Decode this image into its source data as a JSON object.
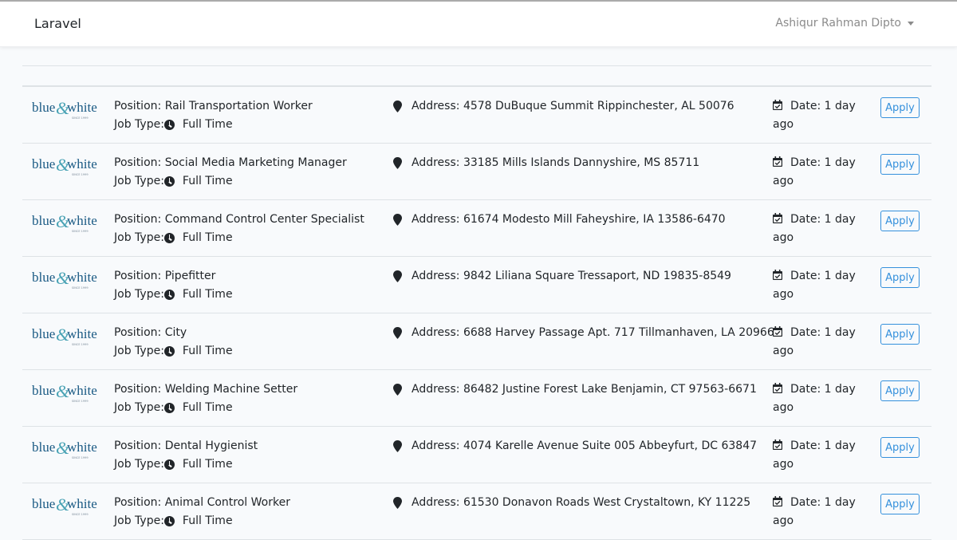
{
  "navbar": {
    "brand": "Laravel",
    "user_name": "Ashiqur Rahman Dipto"
  },
  "logo": {
    "text_left": "blue",
    "ampersand": "&",
    "text_right": "white",
    "tagline": "SINCE 1999"
  },
  "labels": {
    "position_prefix": "Position:",
    "job_type_prefix": "Job Type:",
    "address_prefix": "Address:",
    "date_prefix": "Date:",
    "apply": "Apply"
  },
  "colors": {
    "accent": "#3490dc",
    "logo_blue": "#1a5a84",
    "logo_teal": "#4aa3b5"
  },
  "jobs": [
    {
      "position": "Rail Transportation Worker",
      "job_type": "Full Time",
      "address": "4578 DuBuque Summit Rippinchester, AL 50076",
      "date": "1 day ago"
    },
    {
      "position": "Social Media Marketing Manager",
      "job_type": "Full Time",
      "address": "33185 Mills Islands Dannyshire, MS 85711",
      "date": "1 day ago"
    },
    {
      "position": "Command Control Center Specialist",
      "job_type": "Full Time",
      "address": "61674 Modesto Mill Faheyshire, IA 13586-6470",
      "date": "1 day ago"
    },
    {
      "position": "Pipefitter",
      "job_type": "Full Time",
      "address": "9842 Liliana Square Tressaport, ND 19835-8549",
      "date": "1 day ago"
    },
    {
      "position": "City",
      "job_type": "Full Time",
      "address": "6688 Harvey Passage Apt. 717 Tillmanhaven, LA 20966",
      "date": "1 day ago"
    },
    {
      "position": "Welding Machine Setter",
      "job_type": "Full Time",
      "address": "86482 Justine Forest Lake Benjamin, CT 97563-6671",
      "date": "1 day ago"
    },
    {
      "position": "Dental Hygienist",
      "job_type": "Full Time",
      "address": "4074 Karelle Avenue Suite 005 Abbeyfurt, DC 63847",
      "date": "1 day ago"
    },
    {
      "position": "Animal Control Worker",
      "job_type": "Full Time",
      "address": "61530 Donavon Roads West Crystaltown, KY 11225",
      "date": "1 day ago"
    }
  ]
}
